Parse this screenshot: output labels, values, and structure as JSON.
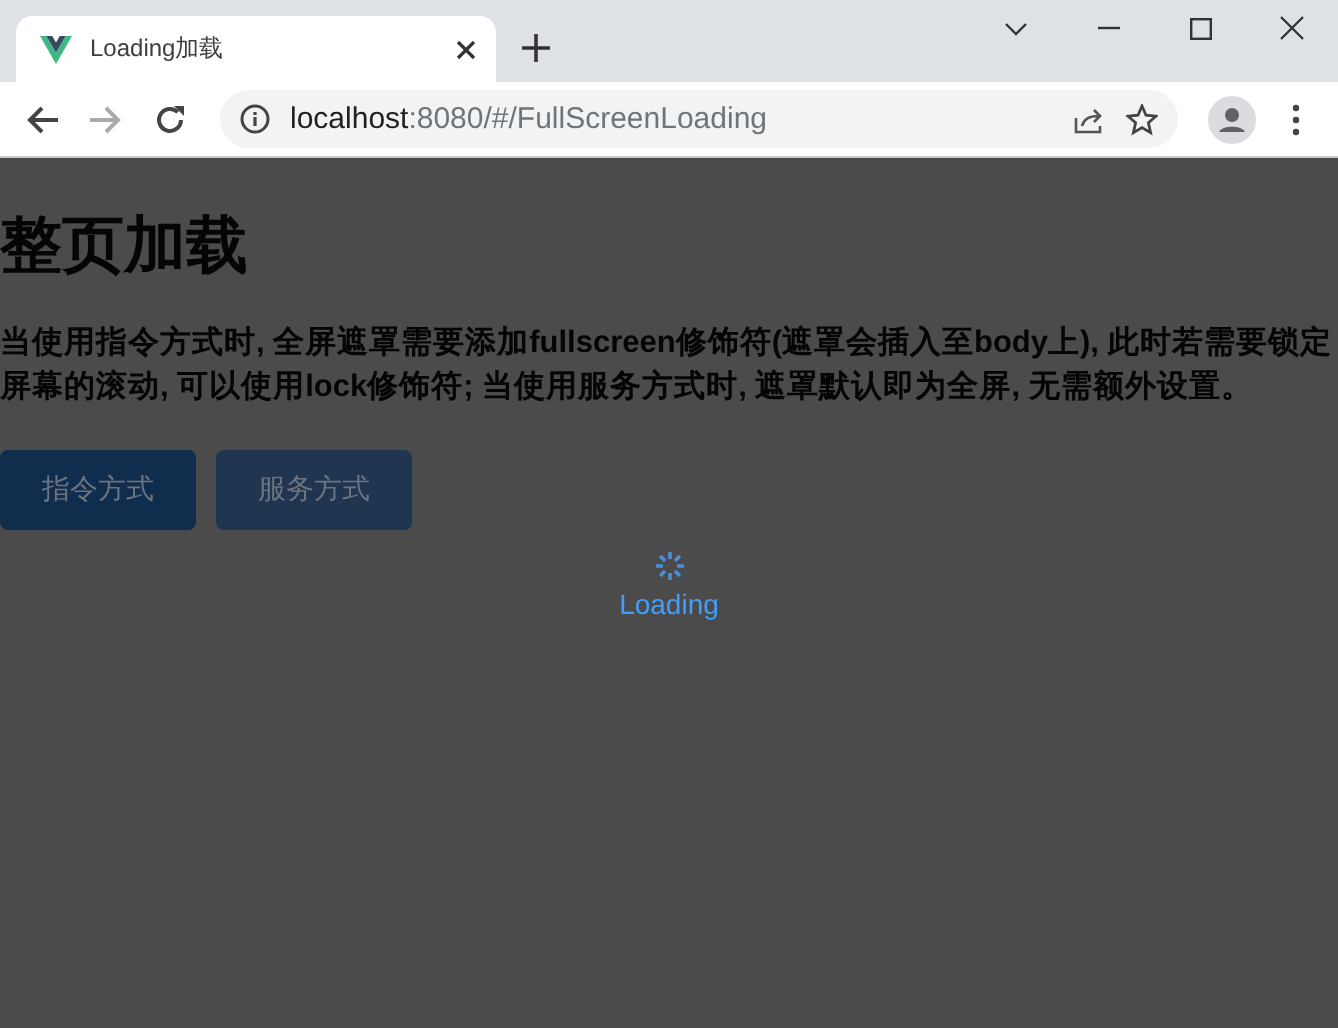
{
  "browser": {
    "tabs": [
      {
        "title": "Loading加载",
        "selected": true
      }
    ],
    "url": {
      "host": "localhost",
      "path": ":8080/#/FullScreenLoading"
    }
  },
  "page": {
    "title": "整页加载",
    "description": "当使用指令方式时, 全屏遮罩需要添加fullscreen修饰符(遮罩会插入至body上), 此时若需要锁定屏幕的滚动, 可以使用lock修饰符; 当使用服务方式时, 遮罩默认即为全屏, 无需额外设置。",
    "buttons": [
      {
        "label": "指令方式",
        "kind": "primary"
      },
      {
        "label": "服务方式",
        "kind": "plain"
      }
    ],
    "loading": {
      "text": "Loading"
    }
  }
}
